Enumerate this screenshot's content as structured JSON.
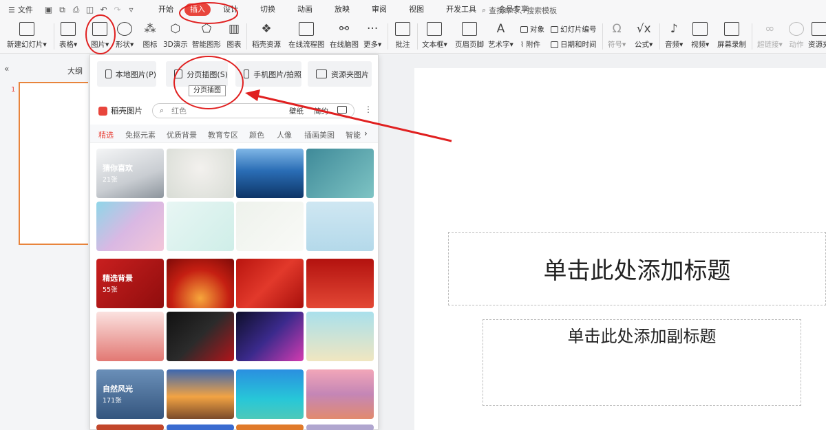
{
  "menubar": {
    "file_label": "文件",
    "tabs": [
      "开始",
      "插入",
      "设计",
      "切换",
      "动画",
      "放映",
      "审阅",
      "视图",
      "开发工具",
      "会员专享"
    ],
    "active_tab": "插入",
    "search_placeholder": "查找命令、搜索模板"
  },
  "ribbon": {
    "new_slide": "新建幻灯片",
    "table": "表格",
    "picture": "图片",
    "shape": "形状",
    "icon": "图标",
    "demo3d": "3D演示",
    "smartart": "智能图形",
    "chart": "图表",
    "daoke_res": "稻壳资源",
    "online_flow": "在线流程图",
    "online_mind": "在线脑图",
    "more": "更多",
    "comment": "批注",
    "textbox": "文本框",
    "header_footer": "页眉页脚",
    "wordart": "艺术字",
    "object": "对象",
    "attachment": "附件",
    "slide_number": "幻灯片编号",
    "date_time": "日期和时间",
    "symbol": "符号",
    "formula": "公式",
    "audio": "音频",
    "video": "视频",
    "screen_record": "屏幕录制",
    "hyperlink": "超链接",
    "action": "动作",
    "resource": "资源夹"
  },
  "leftpanel": {
    "outline": "大纲",
    "slide_number": "1"
  },
  "slide": {
    "title_placeholder": "单击此处添加标题",
    "subtitle_placeholder": "单击此处添加副标题"
  },
  "picture_menu": {
    "local_picture": "本地图片(P)",
    "split_insert": "分页插图(S)",
    "phone_picture": "手机图片/拍照",
    "resource_picture": "资源夹图片",
    "tooltip": "分页插图",
    "brand": "稻壳图片",
    "search_value": "红色",
    "opt_wallpaper": "壁纸",
    "opt_simple": "简约",
    "categories": [
      "精选",
      "免抠元素",
      "优质背景",
      "教育专区",
      "颜色",
      "人像",
      "插画美图",
      "智能"
    ],
    "active_category": "精选",
    "collections": [
      {
        "label": "猜你喜欢",
        "count": "21张"
      },
      {
        "label": "精选背景",
        "count": "55张"
      },
      {
        "label": "自然风光",
        "count": "171张"
      }
    ]
  },
  "colors": {
    "accent": "#e8453c",
    "annotation": "#e02020"
  }
}
